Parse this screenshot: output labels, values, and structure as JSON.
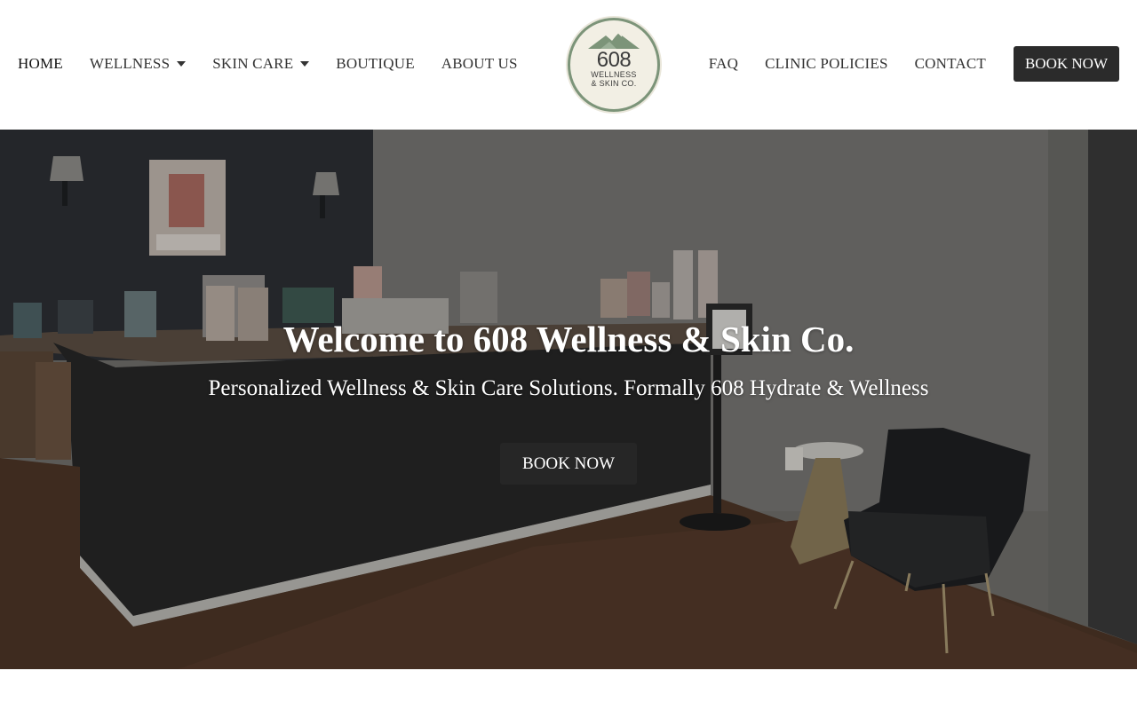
{
  "nav": {
    "left": [
      {
        "label": "HOME"
      },
      {
        "label": "WELLNESS"
      },
      {
        "label": "SKIN CARE"
      },
      {
        "label": "BOUTIQUE"
      },
      {
        "label": "ABOUT US"
      }
    ],
    "right": [
      {
        "label": "FAQ"
      },
      {
        "label": "CLINIC POLICIES"
      },
      {
        "label": "CONTACT"
      }
    ],
    "book_label": "BOOK NOW"
  },
  "logo": {
    "number": "608",
    "line1": "WELLNESS",
    "line2": "& SKIN CO."
  },
  "hero": {
    "title": "Welcome to 608 Wellness & Skin Co.",
    "subtitle": "Personalized Wellness & Skin Care Solutions. Formally 608 Hydrate & Wellness",
    "cta_label": "BOOK NOW"
  },
  "colors": {
    "dark_button": "#2b2b2b",
    "logo_green": "#7c9479",
    "logo_cream": "#f2efe4"
  }
}
